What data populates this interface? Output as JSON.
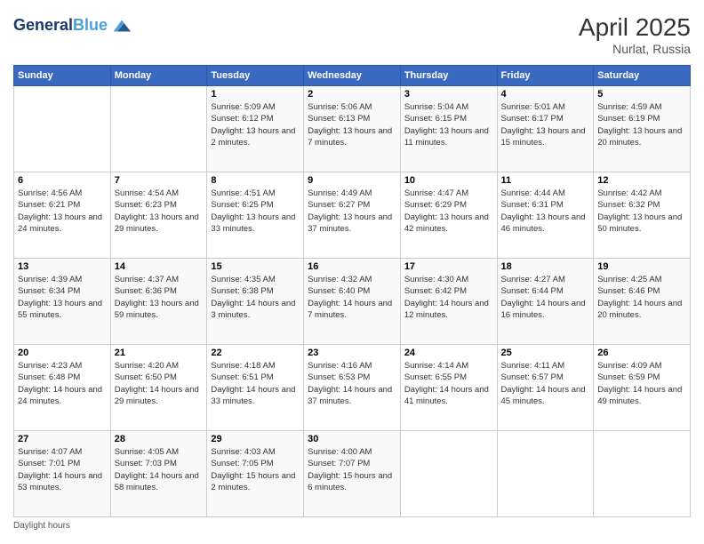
{
  "header": {
    "logo_line1": "General",
    "logo_line2": "Blue",
    "title": "April 2025",
    "subtitle": "Nurlat, Russia"
  },
  "days_of_week": [
    "Sunday",
    "Monday",
    "Tuesday",
    "Wednesday",
    "Thursday",
    "Friday",
    "Saturday"
  ],
  "weeks": [
    [
      {
        "day": "",
        "sunrise": "",
        "sunset": "",
        "daylight": ""
      },
      {
        "day": "",
        "sunrise": "",
        "sunset": "",
        "daylight": ""
      },
      {
        "day": "1",
        "sunrise": "Sunrise: 5:09 AM",
        "sunset": "Sunset: 6:12 PM",
        "daylight": "Daylight: 13 hours and 2 minutes."
      },
      {
        "day": "2",
        "sunrise": "Sunrise: 5:06 AM",
        "sunset": "Sunset: 6:13 PM",
        "daylight": "Daylight: 13 hours and 7 minutes."
      },
      {
        "day": "3",
        "sunrise": "Sunrise: 5:04 AM",
        "sunset": "Sunset: 6:15 PM",
        "daylight": "Daylight: 13 hours and 11 minutes."
      },
      {
        "day": "4",
        "sunrise": "Sunrise: 5:01 AM",
        "sunset": "Sunset: 6:17 PM",
        "daylight": "Daylight: 13 hours and 15 minutes."
      },
      {
        "day": "5",
        "sunrise": "Sunrise: 4:59 AM",
        "sunset": "Sunset: 6:19 PM",
        "daylight": "Daylight: 13 hours and 20 minutes."
      }
    ],
    [
      {
        "day": "6",
        "sunrise": "Sunrise: 4:56 AM",
        "sunset": "Sunset: 6:21 PM",
        "daylight": "Daylight: 13 hours and 24 minutes."
      },
      {
        "day": "7",
        "sunrise": "Sunrise: 4:54 AM",
        "sunset": "Sunset: 6:23 PM",
        "daylight": "Daylight: 13 hours and 29 minutes."
      },
      {
        "day": "8",
        "sunrise": "Sunrise: 4:51 AM",
        "sunset": "Sunset: 6:25 PM",
        "daylight": "Daylight: 13 hours and 33 minutes."
      },
      {
        "day": "9",
        "sunrise": "Sunrise: 4:49 AM",
        "sunset": "Sunset: 6:27 PM",
        "daylight": "Daylight: 13 hours and 37 minutes."
      },
      {
        "day": "10",
        "sunrise": "Sunrise: 4:47 AM",
        "sunset": "Sunset: 6:29 PM",
        "daylight": "Daylight: 13 hours and 42 minutes."
      },
      {
        "day": "11",
        "sunrise": "Sunrise: 4:44 AM",
        "sunset": "Sunset: 6:31 PM",
        "daylight": "Daylight: 13 hours and 46 minutes."
      },
      {
        "day": "12",
        "sunrise": "Sunrise: 4:42 AM",
        "sunset": "Sunset: 6:32 PM",
        "daylight": "Daylight: 13 hours and 50 minutes."
      }
    ],
    [
      {
        "day": "13",
        "sunrise": "Sunrise: 4:39 AM",
        "sunset": "Sunset: 6:34 PM",
        "daylight": "Daylight: 13 hours and 55 minutes."
      },
      {
        "day": "14",
        "sunrise": "Sunrise: 4:37 AM",
        "sunset": "Sunset: 6:36 PM",
        "daylight": "Daylight: 13 hours and 59 minutes."
      },
      {
        "day": "15",
        "sunrise": "Sunrise: 4:35 AM",
        "sunset": "Sunset: 6:38 PM",
        "daylight": "Daylight: 14 hours and 3 minutes."
      },
      {
        "day": "16",
        "sunrise": "Sunrise: 4:32 AM",
        "sunset": "Sunset: 6:40 PM",
        "daylight": "Daylight: 14 hours and 7 minutes."
      },
      {
        "day": "17",
        "sunrise": "Sunrise: 4:30 AM",
        "sunset": "Sunset: 6:42 PM",
        "daylight": "Daylight: 14 hours and 12 minutes."
      },
      {
        "day": "18",
        "sunrise": "Sunrise: 4:27 AM",
        "sunset": "Sunset: 6:44 PM",
        "daylight": "Daylight: 14 hours and 16 minutes."
      },
      {
        "day": "19",
        "sunrise": "Sunrise: 4:25 AM",
        "sunset": "Sunset: 6:46 PM",
        "daylight": "Daylight: 14 hours and 20 minutes."
      }
    ],
    [
      {
        "day": "20",
        "sunrise": "Sunrise: 4:23 AM",
        "sunset": "Sunset: 6:48 PM",
        "daylight": "Daylight: 14 hours and 24 minutes."
      },
      {
        "day": "21",
        "sunrise": "Sunrise: 4:20 AM",
        "sunset": "Sunset: 6:50 PM",
        "daylight": "Daylight: 14 hours and 29 minutes."
      },
      {
        "day": "22",
        "sunrise": "Sunrise: 4:18 AM",
        "sunset": "Sunset: 6:51 PM",
        "daylight": "Daylight: 14 hours and 33 minutes."
      },
      {
        "day": "23",
        "sunrise": "Sunrise: 4:16 AM",
        "sunset": "Sunset: 6:53 PM",
        "daylight": "Daylight: 14 hours and 37 minutes."
      },
      {
        "day": "24",
        "sunrise": "Sunrise: 4:14 AM",
        "sunset": "Sunset: 6:55 PM",
        "daylight": "Daylight: 14 hours and 41 minutes."
      },
      {
        "day": "25",
        "sunrise": "Sunrise: 4:11 AM",
        "sunset": "Sunset: 6:57 PM",
        "daylight": "Daylight: 14 hours and 45 minutes."
      },
      {
        "day": "26",
        "sunrise": "Sunrise: 4:09 AM",
        "sunset": "Sunset: 6:59 PM",
        "daylight": "Daylight: 14 hours and 49 minutes."
      }
    ],
    [
      {
        "day": "27",
        "sunrise": "Sunrise: 4:07 AM",
        "sunset": "Sunset: 7:01 PM",
        "daylight": "Daylight: 14 hours and 53 minutes."
      },
      {
        "day": "28",
        "sunrise": "Sunrise: 4:05 AM",
        "sunset": "Sunset: 7:03 PM",
        "daylight": "Daylight: 14 hours and 58 minutes."
      },
      {
        "day": "29",
        "sunrise": "Sunrise: 4:03 AM",
        "sunset": "Sunset: 7:05 PM",
        "daylight": "Daylight: 15 hours and 2 minutes."
      },
      {
        "day": "30",
        "sunrise": "Sunrise: 4:00 AM",
        "sunset": "Sunset: 7:07 PM",
        "daylight": "Daylight: 15 hours and 6 minutes."
      },
      {
        "day": "",
        "sunrise": "",
        "sunset": "",
        "daylight": ""
      },
      {
        "day": "",
        "sunrise": "",
        "sunset": "",
        "daylight": ""
      },
      {
        "day": "",
        "sunrise": "",
        "sunset": "",
        "daylight": ""
      }
    ]
  ],
  "footer": "Daylight hours"
}
